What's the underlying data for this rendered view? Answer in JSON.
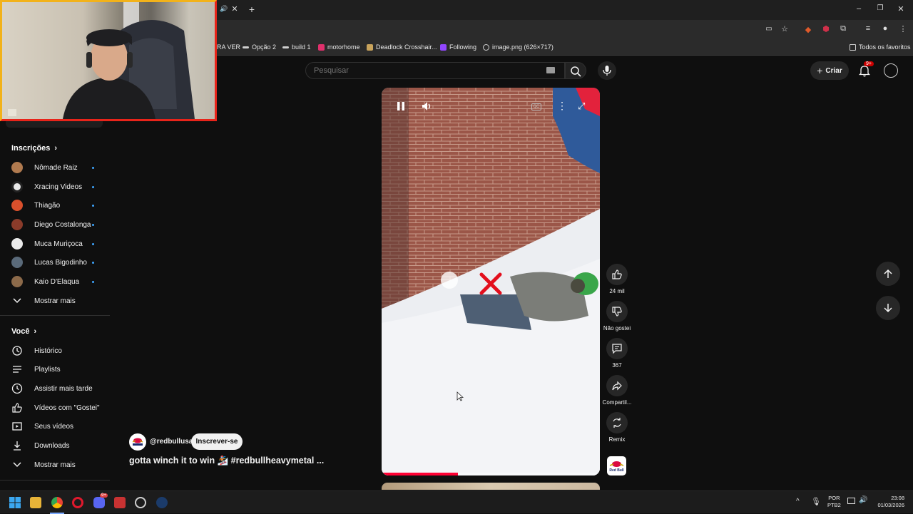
{
  "bookmarks": [
    {
      "label": "RA VER",
      "color": "#555555"
    },
    {
      "label": "Opção 2",
      "color": "#cfcfcf"
    },
    {
      "label": "build 1",
      "color": "#cfcfcf"
    },
    {
      "label": "motorhome",
      "color": "#e1306c"
    },
    {
      "label": "Deadlock Crosshair...",
      "color": "#c9a45c"
    },
    {
      "label": "Following",
      "color": "#9146ff"
    },
    {
      "label": "image.png (626×717)",
      "color": "#cfcfcf"
    }
  ],
  "bookmarks_all": "Todos os favoritos",
  "search": {
    "placeholder": "Pesquisar"
  },
  "header": {
    "create_label": "Criar",
    "notif_badge": "9+"
  },
  "sidebar": {
    "subscriptions_title": "Inscrições",
    "channels": [
      {
        "name": "Nômade Raiz",
        "color": "#b07a4f"
      },
      {
        "name": "Xracing Videos",
        "color": "#e9e9e9"
      },
      {
        "name": "Thiagão",
        "color": "#d9502c"
      },
      {
        "name": "Diego Costalonga",
        "color": "#8a3b2a"
      },
      {
        "name": "Muca Muriçoca",
        "color": "#eaeaea"
      },
      {
        "name": "Lucas Bigodinho",
        "color": "#5a6a7a"
      },
      {
        "name": "Kaio D'Elaqua",
        "color": "#8c6a4a"
      }
    ],
    "show_more_1": "Mostrar mais",
    "you_title": "Você",
    "you_items": [
      {
        "label": "Histórico",
        "icon": "history-icon"
      },
      {
        "label": "Playlists",
        "icon": "playlists-icon"
      },
      {
        "label": "Assistir mais tarde",
        "icon": "watch-later-icon"
      },
      {
        "label": "Vídeos com \"Gostei\"",
        "icon": "like-icon"
      },
      {
        "label": "Seus vídeos",
        "icon": "your-videos-icon"
      },
      {
        "label": "Downloads",
        "icon": "download-icon"
      }
    ],
    "show_more_2": "Mostrar mais"
  },
  "video": {
    "channel": "@redbullusa",
    "subscribe_label": "Inscrever-se",
    "title": "gotta winch it to win 🏂 #redbullheavymetal ...",
    "progress": 0.35,
    "likes": "24 mil",
    "dislike_label": "Não gostei",
    "comments": "367",
    "share_label": "Compartil...",
    "remix_label": "Remix",
    "channel_logo_text": "Red Bull",
    "cc_label": "CC"
  },
  "taskbar": {
    "lang_top": "POR",
    "lang_bottom": "PTB2",
    "time": "23:08",
    "date": "01/03/2026",
    "discord_badge": "9+"
  },
  "colors": {
    "accent": "#ff0033",
    "brand_red": "#db0a40",
    "link_blue": "#3ea6ff"
  }
}
